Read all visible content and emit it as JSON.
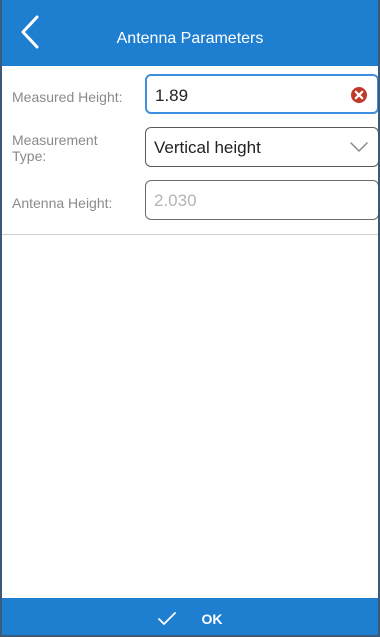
{
  "header": {
    "title": "Antenna Parameters",
    "back_icon": "chevron-left-icon"
  },
  "form": {
    "measured_height": {
      "label": "Measured Height:",
      "value": "1.89",
      "clear_icon": "clear-icon"
    },
    "measurement_type": {
      "label": "Measurement Type:",
      "value": "Vertical height",
      "dropdown_icon": "chevron-down-icon"
    },
    "antenna_height": {
      "label": "Antenna Height:",
      "value": "2.030"
    }
  },
  "footer": {
    "ok_label": "OK",
    "check_icon": "check-icon"
  },
  "colors": {
    "header_bg": "#1e7fd0",
    "active_border": "#3d8fe0",
    "clear_icon": "#c0392b"
  }
}
